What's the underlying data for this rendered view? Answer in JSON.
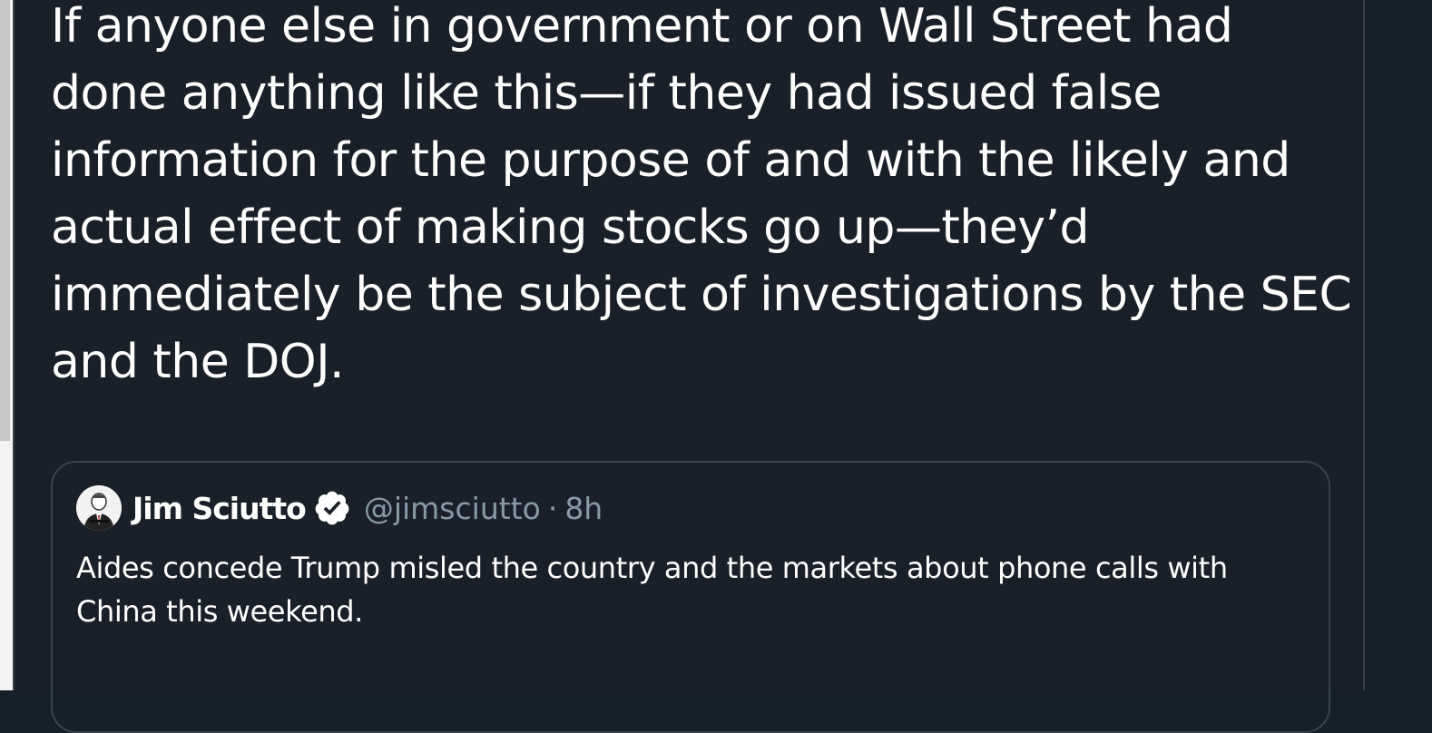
{
  "tweet": {
    "text": "If anyone else in government or on Wall Street had done anything like this—if they had issued false information for the purpose of and with the likely and actual effect of making stocks go up—they’d immediately be the subject of investigations by the SEC and the DOJ."
  },
  "quoted_tweet": {
    "author_name": "Jim Sciutto",
    "handle": "@jimsciutto",
    "separator": "·",
    "timestamp": "8h",
    "text": "Aides concede Trump misled the country and the markets about phone calls with China this weekend.",
    "verified_icon": "verified-badge-icon",
    "avatar_icon": "avatar"
  },
  "colors": {
    "background": "#15202b",
    "card_background": "#192029",
    "border": "#38444d",
    "primary_text": "#ffffff",
    "secondary_text": "#8899a6"
  }
}
